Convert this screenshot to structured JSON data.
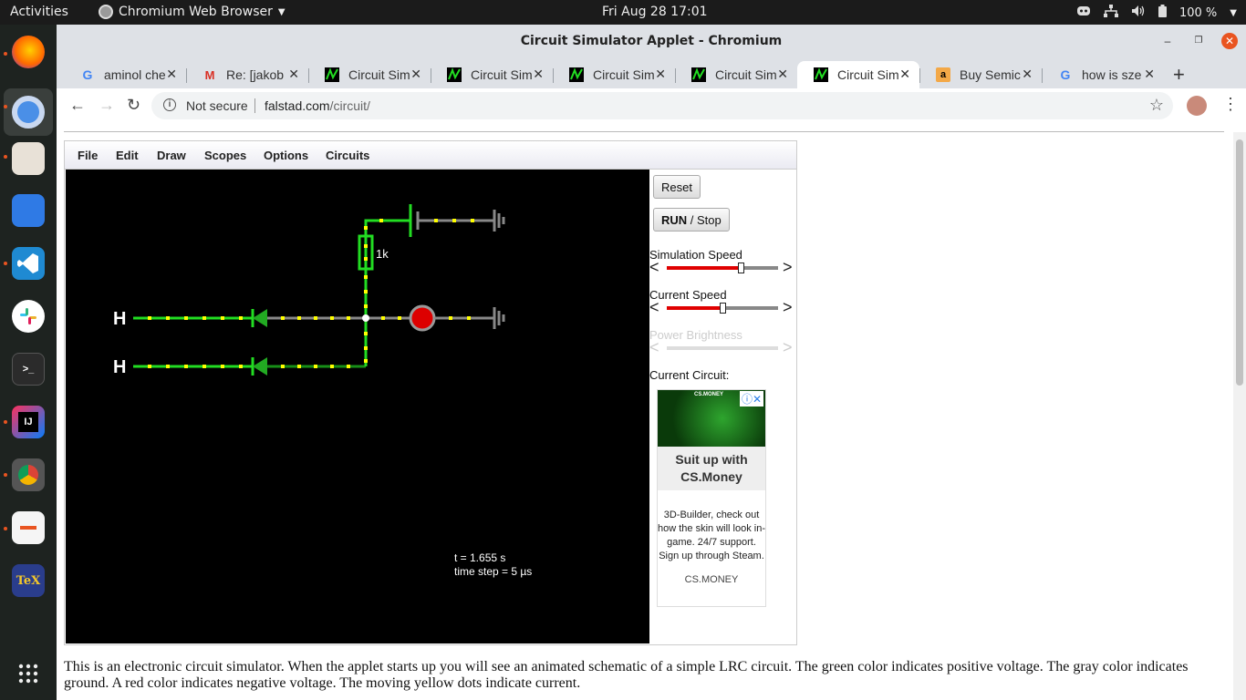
{
  "topbar": {
    "activities": "Activities",
    "app_name": "Chromium Web Browser",
    "clock": "Fri Aug 28  17:01",
    "battery": "100 %"
  },
  "dock": {
    "apps": [
      "firefox-icon",
      "chromium-icon",
      "files-icon",
      "software-icon",
      "vscode-icon",
      "slack-icon",
      "terminal-icon",
      "intellij-icon",
      "screenshot-icon",
      "document-viewer-icon",
      "texmaker-icon"
    ],
    "show_apps": "show-applications-icon"
  },
  "window": {
    "title": "Circuit Simulator Applet - Chromium"
  },
  "tabs": [
    {
      "label": "aminol che",
      "icon": "google-icon"
    },
    {
      "label": "Re: [jakob",
      "icon": "gmail-icon"
    },
    {
      "label": "Circuit Sim",
      "icon": "circuit-icon"
    },
    {
      "label": "Circuit Sim",
      "icon": "circuit-icon"
    },
    {
      "label": "Circuit Sim",
      "icon": "circuit-icon"
    },
    {
      "label": "Circuit Sim",
      "icon": "circuit-icon"
    },
    {
      "label": "Circuit Sim",
      "icon": "circuit-icon",
      "active": true
    },
    {
      "label": "Buy Semic",
      "icon": "amazon-icon"
    },
    {
      "label": "how is sze",
      "icon": "google-icon"
    }
  ],
  "toolbar": {
    "security": "Not secure",
    "url_host": "falstad.com",
    "url_path": "/circuit/"
  },
  "applet": {
    "menu": [
      "File",
      "Edit",
      "Draw",
      "Scopes",
      "Options",
      "Circuits"
    ],
    "reset": "Reset",
    "run_label": "RUN",
    "stop_label": " / Stop",
    "sim_speed": {
      "label": "Simulation Speed",
      "value": 0.66
    },
    "current_speed": {
      "label": "Current Speed",
      "value": 0.5
    },
    "power_brightness": {
      "label": "Power Brightness",
      "disabled": true
    },
    "current_circuit_label": "Current Circuit:",
    "canvas": {
      "time": "t = 1.655 s",
      "timestep": "time step = 5 µs",
      "resistor_label": "1k",
      "input1": "H",
      "input2": "H"
    },
    "ad": {
      "brand_tag": "CS.MONEY",
      "headline": "Suit up with CS.Money",
      "body": "3D-Builder, check out how the skin will look in-game. 24/7 support. Sign up through Steam.",
      "domain": "CS.MONEY"
    }
  },
  "description": "This is an electronic circuit simulator.  When the applet starts up you will see an animated schematic of a simple LRC circuit. The green color indicates positive voltage.  The gray color indicates ground.  A red color indicates negative voltage.  The moving yellow dots indicate current.",
  "colors": {
    "positive": "#22dd22",
    "ground": "#808080",
    "current_dots": "#ffff00",
    "led": "#dd0000"
  }
}
